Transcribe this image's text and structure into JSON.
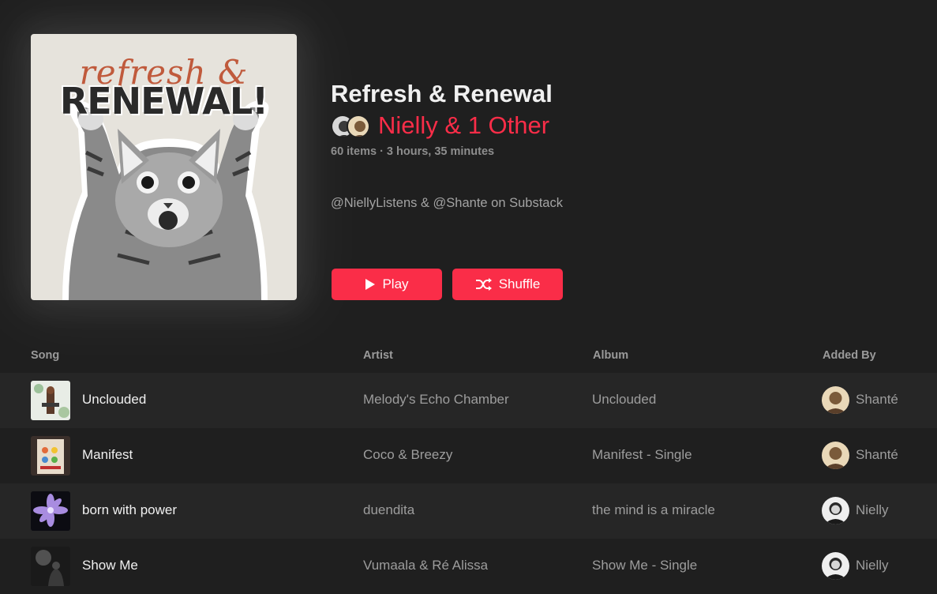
{
  "playlist": {
    "title": "Refresh & Renewal",
    "curators": "Nielly & 1 Other",
    "meta": "60 items · 3 hours, 35 minutes",
    "description": "@NiellyListens & @Shante on Substack",
    "artwork_text_script": "refresh &",
    "artwork_text_block": "RENEWAL!"
  },
  "actions": {
    "play_label": "Play",
    "shuffle_label": "Shuffle"
  },
  "columns": {
    "song": "Song",
    "artist": "Artist",
    "album": "Album",
    "added_by": "Added By"
  },
  "tracks": [
    {
      "song": "Unclouded",
      "artist": "Melody's Echo Chamber",
      "album": "Unclouded",
      "added_by": "Shanté"
    },
    {
      "song": "Manifest",
      "artist": "Coco & Breezy",
      "album": "Manifest - Single",
      "added_by": "Shanté"
    },
    {
      "song": "born with power",
      "artist": "duendita",
      "album": "the mind is a miracle",
      "added_by": "Nielly"
    },
    {
      "song": "Show Me",
      "artist": "Vumaala & Ré Alissa",
      "album": "Show Me - Single",
      "added_by": "Nielly"
    }
  ],
  "colors": {
    "accent": "#fa2d48",
    "background": "#1f1f1f",
    "row_alt": "#262626"
  },
  "icons": [
    "play-icon",
    "shuffle-icon",
    "avatar",
    "album-artwork"
  ]
}
